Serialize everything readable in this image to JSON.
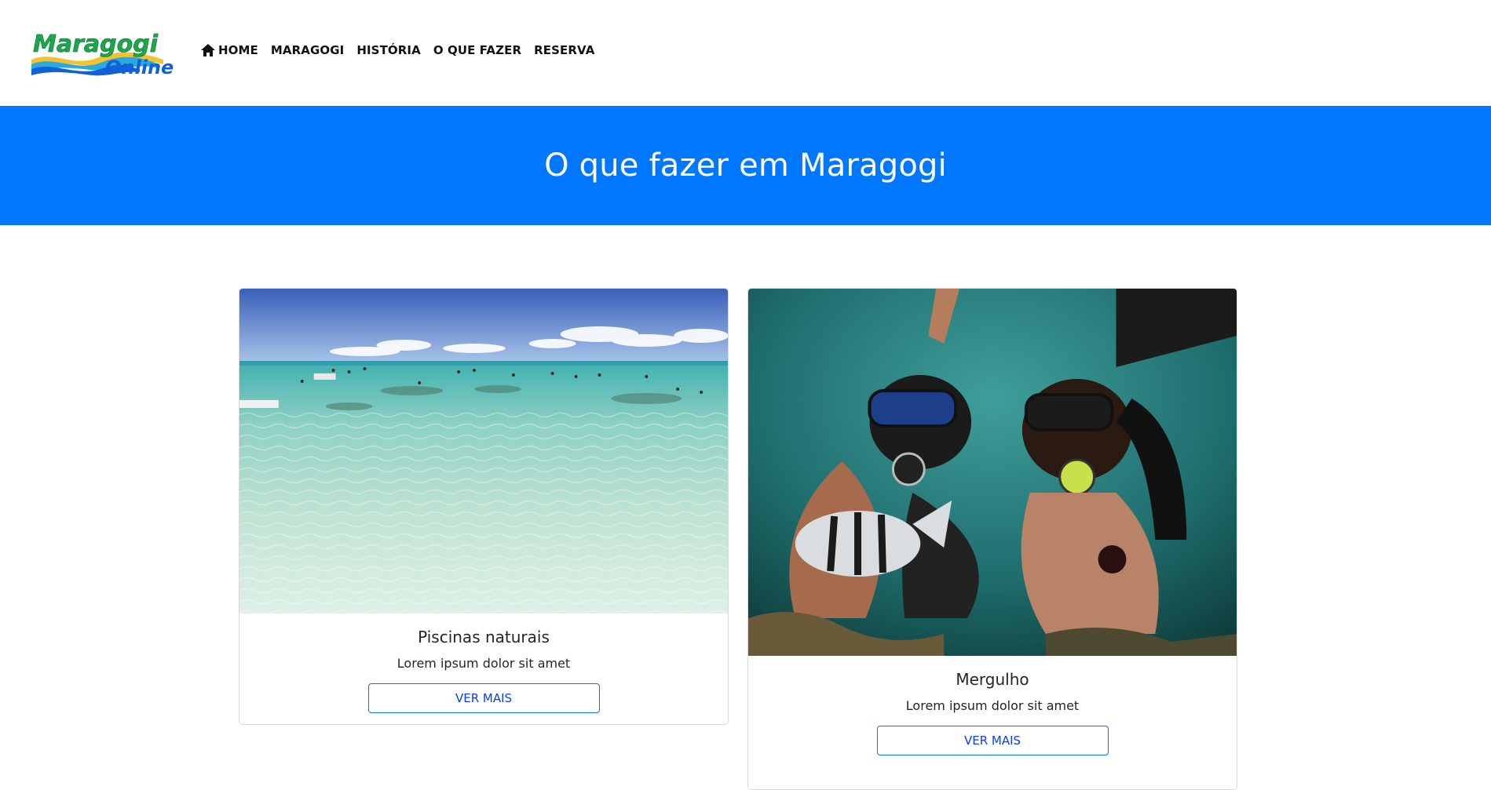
{
  "brand": {
    "logo_line1": "Maragogi",
    "logo_line2": "Online",
    "colors": {
      "green": "#1aa84a",
      "blue": "#1060d8",
      "yellow": "#f2c230",
      "wave_blue": "#2aa8e0"
    }
  },
  "nav": {
    "items": [
      {
        "label": "HOME",
        "icon": "home-icon"
      },
      {
        "label": "MARAGOGI"
      },
      {
        "label": "HISTÓRIA"
      },
      {
        "label": "O QUE FAZER"
      },
      {
        "label": "RESERVA"
      }
    ]
  },
  "hero": {
    "title": "O que fazer em Maragogi",
    "background": "#0077ff"
  },
  "cards": [
    {
      "title": "Piscinas naturais",
      "text": "Lorem ipsum dolor sit amet",
      "button": "VER MAIS",
      "image": "natural-pools-photo"
    },
    {
      "title": "Mergulho",
      "text": "Lorem ipsum dolor sit amet",
      "button": "VER MAIS",
      "image": "scuba-diving-photo"
    }
  ]
}
